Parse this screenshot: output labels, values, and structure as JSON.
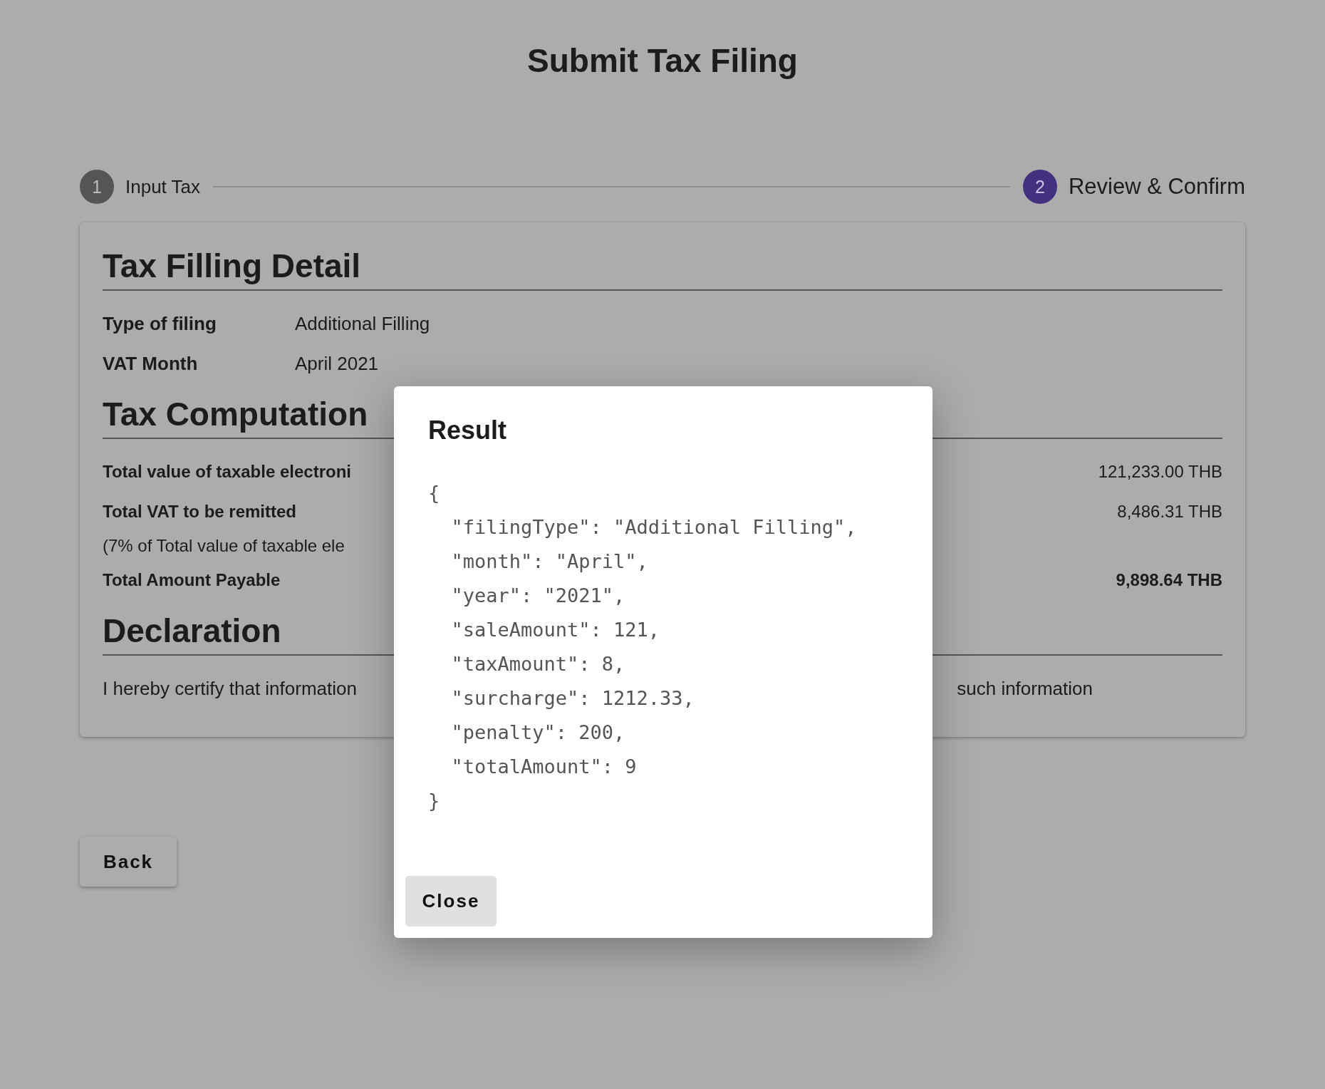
{
  "page": {
    "title": "Submit Tax Filing"
  },
  "stepper": [
    {
      "number": "1",
      "label": "Input Tax",
      "selected": false
    },
    {
      "number": "2",
      "label": "Review & Confirm",
      "selected": true
    }
  ],
  "detail": {
    "heading": "Tax Filling Detail",
    "rows": [
      {
        "label": "Type of filing",
        "value": "Additional Filling"
      },
      {
        "label": "VAT Month",
        "value": "April 2021"
      }
    ]
  },
  "computation": {
    "heading": "Tax Computation",
    "rows": [
      {
        "kind": "main",
        "label": "Total value of taxable electroni",
        "value": "121,233.00 THB"
      },
      {
        "kind": "main",
        "label": "Total VAT to be remitted",
        "value": "8,486.31 THB"
      },
      {
        "kind": "note",
        "label": "(7% of Total value of taxable ele"
      },
      {
        "kind": "total",
        "label": "Total Amount Payable",
        "value": "9,898.64 THB"
      }
    ]
  },
  "declaration": {
    "heading": "Declaration",
    "text_left": "I hereby certify that information",
    "text_right": "such information"
  },
  "back_button": "Back",
  "dialog": {
    "title": "Result",
    "code_lines": [
      "{",
      "  \"filingType\": \"Additional Filling\",",
      "  \"month\": \"April\",",
      "  \"year\": \"2021\",",
      "  \"saleAmount\": 121,",
      "  \"taxAmount\": 8,",
      "  \"surcharge\": 1212.33,",
      "  \"penalty\": 200,",
      "  \"totalAmount\": 9",
      "}"
    ],
    "close_button": "Close"
  }
}
